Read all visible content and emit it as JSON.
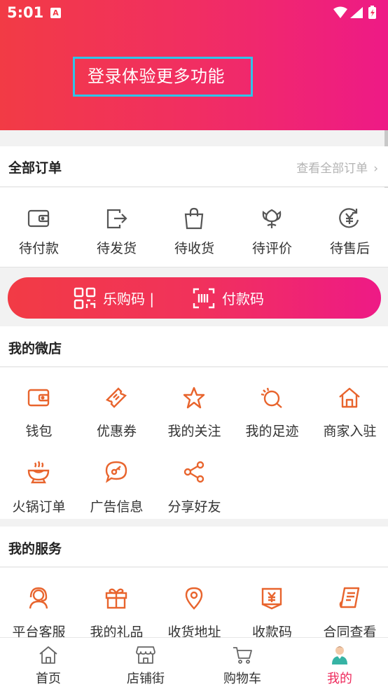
{
  "status_bar": {
    "time": "5:01",
    "notification_glyph": "A"
  },
  "header": {
    "login_prompt": "登录体验更多功能"
  },
  "orders": {
    "title": "全部订单",
    "view_all": "查看全部订单",
    "items": [
      {
        "label": "待付款",
        "icon": "wallet-icon"
      },
      {
        "label": "待发货",
        "icon": "ship-out-icon"
      },
      {
        "label": "待收货",
        "icon": "shopping-bag-icon"
      },
      {
        "label": "待评价",
        "icon": "flower-icon"
      },
      {
        "label": "待售后",
        "icon": "refund-yen-icon"
      }
    ]
  },
  "pay_bar": {
    "left_label": "乐购码 |",
    "right_label": "付款码"
  },
  "micro_shop": {
    "title": "我的微店",
    "items": [
      {
        "label": "钱包",
        "icon": "wallet-icon"
      },
      {
        "label": "优惠券",
        "icon": "coupon-icon"
      },
      {
        "label": "我的关注",
        "icon": "star-icon"
      },
      {
        "label": "我的足迹",
        "icon": "footprint-icon"
      },
      {
        "label": "商家入驻",
        "icon": "home-icon"
      },
      {
        "label": "火锅订单",
        "icon": "hotpot-icon"
      },
      {
        "label": "广告信息",
        "icon": "ad-message-icon"
      },
      {
        "label": "分享好友",
        "icon": "share-icon"
      }
    ]
  },
  "services": {
    "title": "我的服务",
    "items": [
      {
        "label": "平台客服",
        "icon": "headset-icon"
      },
      {
        "label": "我的礼品",
        "icon": "gift-icon"
      },
      {
        "label": "收货地址",
        "icon": "location-pin-icon"
      },
      {
        "label": "收款码",
        "icon": "receive-money-icon"
      },
      {
        "label": "合同查看",
        "icon": "contract-icon"
      }
    ]
  },
  "tabbar": {
    "items": [
      {
        "label": "首页",
        "icon": "home-tab-icon",
        "active": false
      },
      {
        "label": "店铺街",
        "icon": "store-icon",
        "active": false
      },
      {
        "label": "购物车",
        "icon": "cart-icon",
        "active": false
      },
      {
        "label": "我的",
        "icon": "profile-icon",
        "active": true
      }
    ]
  },
  "colors": {
    "brand_red": "#f23b45",
    "brand_pink": "#ee1a86",
    "icon_orange": "#e8642d",
    "icon_gray": "#555555",
    "active_tab": "#ee2a5c",
    "highlight_box": "#2fc4e8"
  }
}
